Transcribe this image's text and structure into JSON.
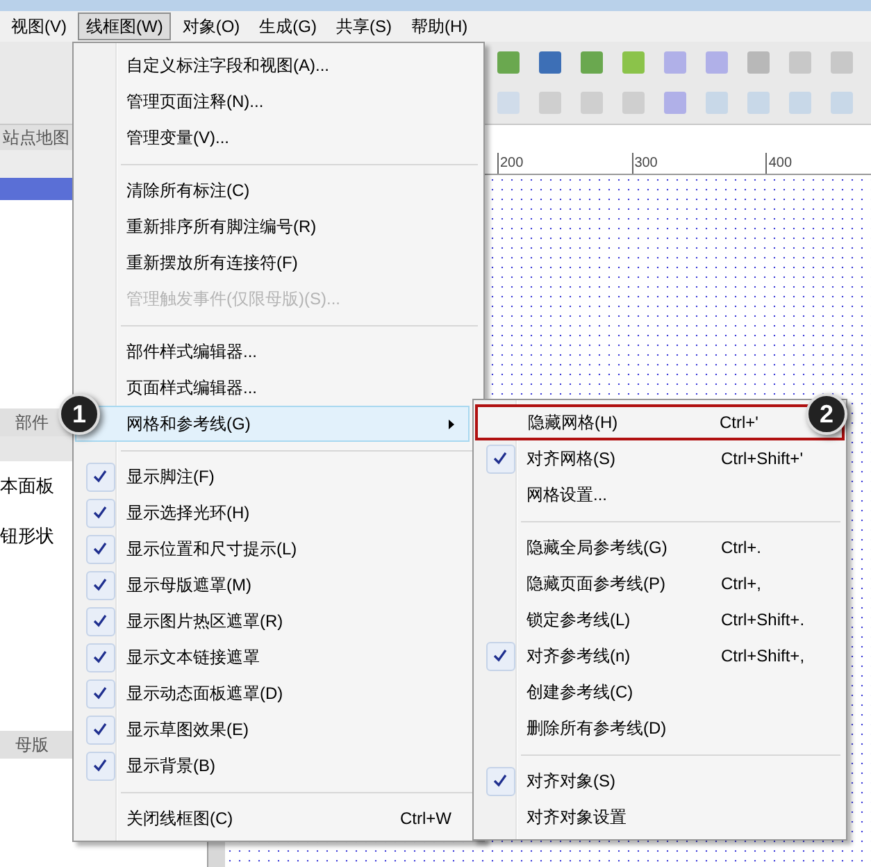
{
  "menu_bar": [
    {
      "label": "视图(V)",
      "selected": false
    },
    {
      "label": "线框图(W)",
      "selected": true
    },
    {
      "label": "对象(O)",
      "selected": false
    },
    {
      "label": "生成(G)",
      "selected": false
    },
    {
      "label": "共享(S)",
      "selected": false
    },
    {
      "label": "帮助(H)",
      "selected": false
    }
  ],
  "left_panel": {
    "sitemap_title": "站点地图",
    "widgets_title": "部件",
    "widget_items": [
      "本面板",
      "钮形状"
    ],
    "masters_title": "母版"
  },
  "ruler": {
    "labels": [
      "200",
      "300",
      "400"
    ]
  },
  "wireframe_menu": {
    "items": [
      {
        "kind": "item",
        "label": "自定义标注字段和视图(A)...",
        "checked": false,
        "disabled": false,
        "selected": false
      },
      {
        "kind": "item",
        "label": "管理页面注释(N)...",
        "checked": false,
        "disabled": false,
        "selected": false
      },
      {
        "kind": "item",
        "label": "管理变量(V)...",
        "checked": false,
        "disabled": false,
        "selected": false
      },
      {
        "kind": "separator"
      },
      {
        "kind": "item",
        "label": "清除所有标注(C)",
        "checked": false,
        "disabled": false,
        "selected": false
      },
      {
        "kind": "item",
        "label": "重新排序所有脚注编号(R)",
        "checked": false,
        "disabled": false,
        "selected": false
      },
      {
        "kind": "item",
        "label": "重新摆放所有连接符(F)",
        "checked": false,
        "disabled": false,
        "selected": false
      },
      {
        "kind": "item",
        "label": "管理触发事件(仅限母版)(S)...",
        "checked": false,
        "disabled": true,
        "selected": false
      },
      {
        "kind": "separator"
      },
      {
        "kind": "item",
        "label": "部件样式编辑器...",
        "checked": false,
        "disabled": false,
        "selected": false
      },
      {
        "kind": "item",
        "label": "页面样式编辑器...",
        "checked": false,
        "disabled": false,
        "selected": false
      },
      {
        "kind": "submenu",
        "label": "网格和参考线(G)",
        "checked": false,
        "disabled": false,
        "selected": true
      },
      {
        "kind": "separator"
      },
      {
        "kind": "item",
        "label": "显示脚注(F)",
        "checked": true,
        "disabled": false,
        "selected": false
      },
      {
        "kind": "item",
        "label": "显示选择光环(H)",
        "checked": true,
        "disabled": false,
        "selected": false
      },
      {
        "kind": "item",
        "label": "显示位置和尺寸提示(L)",
        "checked": true,
        "disabled": false,
        "selected": false
      },
      {
        "kind": "item",
        "label": "显示母版遮罩(M)",
        "checked": true,
        "disabled": false,
        "selected": false
      },
      {
        "kind": "item",
        "label": "显示图片热区遮罩(R)",
        "checked": true,
        "disabled": false,
        "selected": false
      },
      {
        "kind": "item",
        "label": "显示文本链接遮罩",
        "checked": true,
        "disabled": false,
        "selected": false
      },
      {
        "kind": "item",
        "label": "显示动态面板遮罩(D)",
        "checked": true,
        "disabled": false,
        "selected": false
      },
      {
        "kind": "item",
        "label": "显示草图效果(E)",
        "checked": true,
        "disabled": false,
        "selected": false
      },
      {
        "kind": "item",
        "label": "显示背景(B)",
        "checked": true,
        "disabled": false,
        "selected": false
      },
      {
        "kind": "separator"
      },
      {
        "kind": "item",
        "label": "关闭线框图(C)",
        "shortcut": "Ctrl+W",
        "checked": false,
        "disabled": false,
        "selected": false
      }
    ]
  },
  "grid_submenu": {
    "items": [
      {
        "kind": "item",
        "label": "隐藏网格(H)",
        "shortcut": "Ctrl+'",
        "checked": false,
        "selected": true
      },
      {
        "kind": "item",
        "label": "对齐网格(S)",
        "shortcut": "Ctrl+Shift+'",
        "checked": true,
        "selected": false
      },
      {
        "kind": "item",
        "label": "网格设置...",
        "checked": false,
        "selected": false
      },
      {
        "kind": "separator"
      },
      {
        "kind": "item",
        "label": "隐藏全局参考线(G)",
        "shortcut": "Ctrl+.",
        "checked": false,
        "selected": false
      },
      {
        "kind": "item",
        "label": "隐藏页面参考线(P)",
        "shortcut": "Ctrl+,",
        "checked": false,
        "selected": false
      },
      {
        "kind": "item",
        "label": "锁定参考线(L)",
        "shortcut": "Ctrl+Shift+.",
        "checked": false,
        "selected": false
      },
      {
        "kind": "item",
        "label": "对齐参考线(n)",
        "shortcut": "Ctrl+Shift+,",
        "checked": true,
        "selected": false
      },
      {
        "kind": "item",
        "label": "创建参考线(C)",
        "checked": false,
        "selected": false
      },
      {
        "kind": "item",
        "label": "删除所有参考线(D)",
        "checked": false,
        "selected": false
      },
      {
        "kind": "separator"
      },
      {
        "kind": "item",
        "label": "对齐对象(S)",
        "checked": true,
        "selected": false
      },
      {
        "kind": "item",
        "label": "对齐对象设置",
        "checked": false,
        "selected": false
      }
    ]
  },
  "callouts": [
    "1",
    "2"
  ]
}
